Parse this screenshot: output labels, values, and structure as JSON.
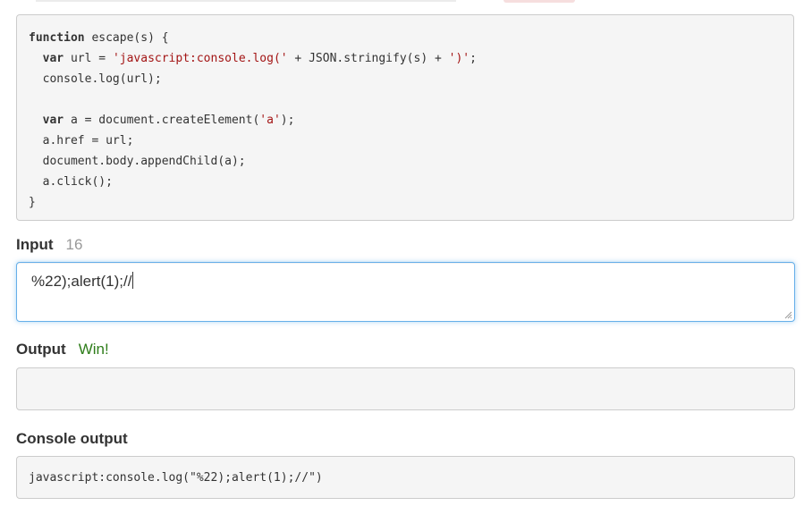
{
  "code": {
    "lines": [
      [
        {
          "t": "function",
          "k": "kw"
        },
        {
          "t": " escape(s) {",
          "k": ""
        }
      ],
      [
        {
          "t": "  ",
          "k": ""
        },
        {
          "t": "var",
          "k": "kw"
        },
        {
          "t": " url = ",
          "k": ""
        },
        {
          "t": "'javascript:console.log('",
          "k": "str"
        },
        {
          "t": " + JSON.stringify(s) + ",
          "k": ""
        },
        {
          "t": "')'",
          "k": "str"
        },
        {
          "t": ";",
          "k": ""
        }
      ],
      [
        {
          "t": "  console.log(url);",
          "k": ""
        }
      ],
      [
        {
          "t": "",
          "k": ""
        }
      ],
      [
        {
          "t": "  ",
          "k": ""
        },
        {
          "t": "var",
          "k": "kw"
        },
        {
          "t": " a = document.createElement(",
          "k": ""
        },
        {
          "t": "'a'",
          "k": "str"
        },
        {
          "t": ");",
          "k": ""
        }
      ],
      [
        {
          "t": "  a.href = url;",
          "k": ""
        }
      ],
      [
        {
          "t": "  document.body.appendChild(a);",
          "k": ""
        }
      ],
      [
        {
          "t": "  a.click();",
          "k": ""
        }
      ],
      [
        {
          "t": "}",
          "k": ""
        }
      ]
    ]
  },
  "input": {
    "label": "Input",
    "count": "16",
    "value": "%22);alert(1);//"
  },
  "output": {
    "label": "Output",
    "status": "Win!",
    "value": ""
  },
  "console": {
    "label": "Console output",
    "value": "javascript:console.log(\"%22);alert(1);//\")"
  },
  "colors": {
    "keyword": "#333333",
    "string": "#a31515",
    "win": "#2e7d1a",
    "focus": "#66afe9"
  }
}
